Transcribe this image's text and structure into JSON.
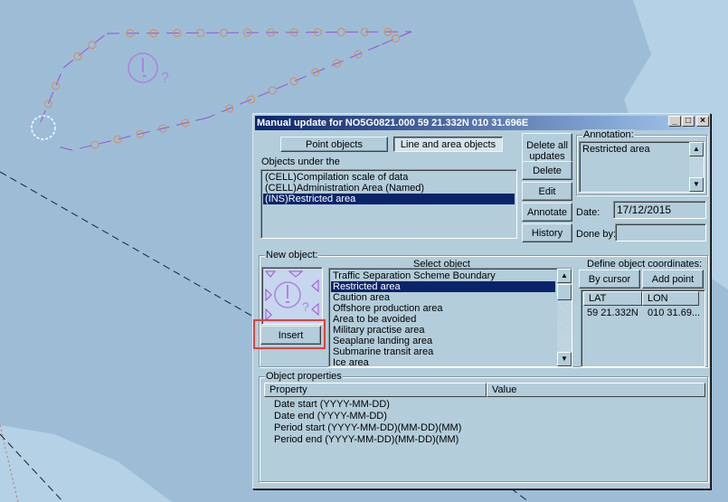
{
  "colors": {
    "map_water": "#9dbdd7",
    "map_shallow": "#b4d1e6",
    "area_line": "#9b4fd6",
    "area_circle": "#d98a50",
    "dialog_bg": "#b3cdda",
    "selection": "#0a246a",
    "highlight_box": "#e04040"
  },
  "map": {
    "symbol_question": "?"
  },
  "dialog": {
    "title": "Manual update for NO5G0821.000  59 21.332N  010 31.696E",
    "window_controls": {
      "minimize": "_",
      "maximize": "□",
      "close": "×"
    },
    "tabs": [
      {
        "label": "Point objects",
        "active": false
      },
      {
        "label": "Line and area objects",
        "active": true
      }
    ],
    "objects_under_label": "Objects under the",
    "objects_under": [
      {
        "text": "(CELL)Compilation scale of data",
        "selected": false
      },
      {
        "text": "(CELL)Administration Area (Named)",
        "selected": false
      },
      {
        "text": "(INS)Restricted area",
        "selected": true
      }
    ],
    "actions": {
      "delete_all": "Delete all updates",
      "delete": "Delete",
      "edit": "Edit",
      "annotate": "Annotate",
      "history": "History"
    },
    "annotation": {
      "label": "Annotation:",
      "text": "Restricted area"
    },
    "date": {
      "label": "Date:",
      "value": "17/12/2015"
    },
    "done_by": {
      "label": "Done by:",
      "value": ""
    },
    "new_object": {
      "label": "New object:",
      "insert": "Insert",
      "select_label": "Select object",
      "items": [
        {
          "text": "Traffic Separation Scheme  Boundary",
          "selected": false
        },
        {
          "text": "Restricted area",
          "selected": true
        },
        {
          "text": "Caution area",
          "selected": false
        },
        {
          "text": "Offshore production area",
          "selected": false
        },
        {
          "text": "Area to be avoided",
          "selected": false
        },
        {
          "text": "Military practise area",
          "selected": false
        },
        {
          "text": "Seaplane landing area",
          "selected": false
        },
        {
          "text": "Submarine transit area",
          "selected": false
        },
        {
          "text": "Ice area",
          "selected": false
        }
      ],
      "coords_label": "Define object coordinates:",
      "by_cursor": "By cursor",
      "add_point": "Add point",
      "columns": [
        "LAT",
        "LON"
      ],
      "rows": [
        [
          "59 21.332N",
          "010 31.69..."
        ]
      ]
    },
    "properties": {
      "label": "Object properties",
      "columns": [
        "Property",
        "Value"
      ],
      "rows": [
        "Date start (YYYY-MM-DD)",
        "Date end (YYYY-MM-DD)",
        "Period start (YYYY-MM-DD)(MM-DD)(MM)",
        "Period end (YYYY-MM-DD)(MM-DD)(MM)"
      ]
    }
  }
}
